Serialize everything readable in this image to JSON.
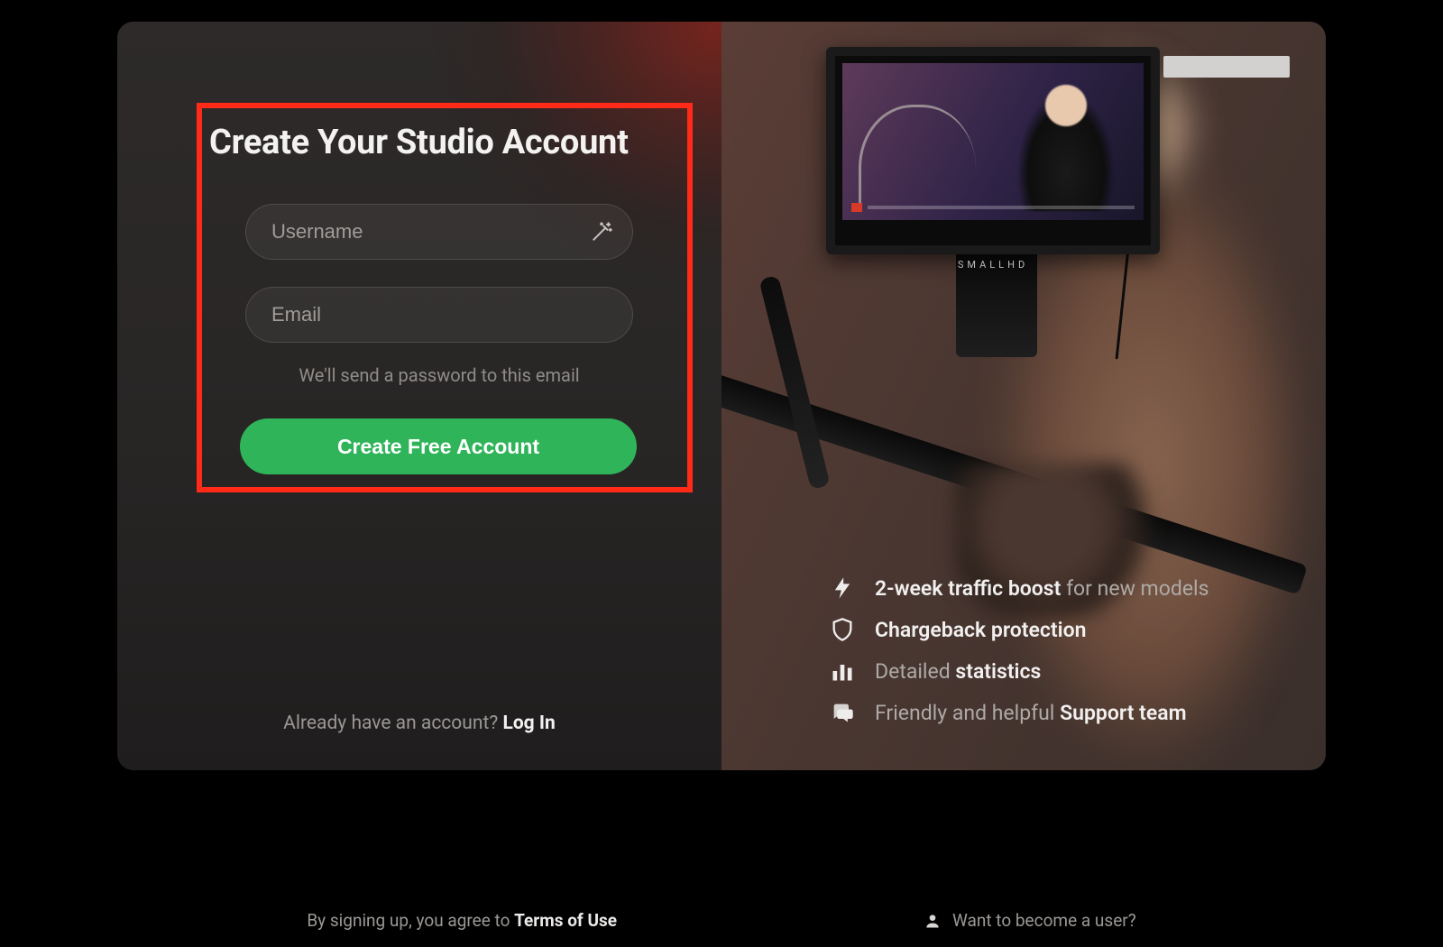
{
  "form": {
    "title": "Create Your Studio Account",
    "username_placeholder": "Username",
    "email_placeholder": "Email",
    "email_helper": "We'll send a password to this email",
    "cta_label": "Create Free Account"
  },
  "already": {
    "prefix": "Already have an account? ",
    "login_label": "Log In"
  },
  "benefits": [
    {
      "icon": "bolt",
      "strong": "2-week traffic boost ",
      "muted": "for new models"
    },
    {
      "icon": "shield",
      "strong": "Chargeback protection",
      "muted": ""
    },
    {
      "icon": "bars",
      "muted_first": "Detailed ",
      "strong": "statistics"
    },
    {
      "icon": "chat",
      "muted_first": "Friendly and helpful ",
      "strong": "Support team"
    }
  ],
  "footer": {
    "terms_prefix": "By signing up, you agree to ",
    "terms_label": "Terms of Use",
    "user_link": "Want to become a user?"
  },
  "monitor": {
    "brand": "SMALLHD"
  }
}
